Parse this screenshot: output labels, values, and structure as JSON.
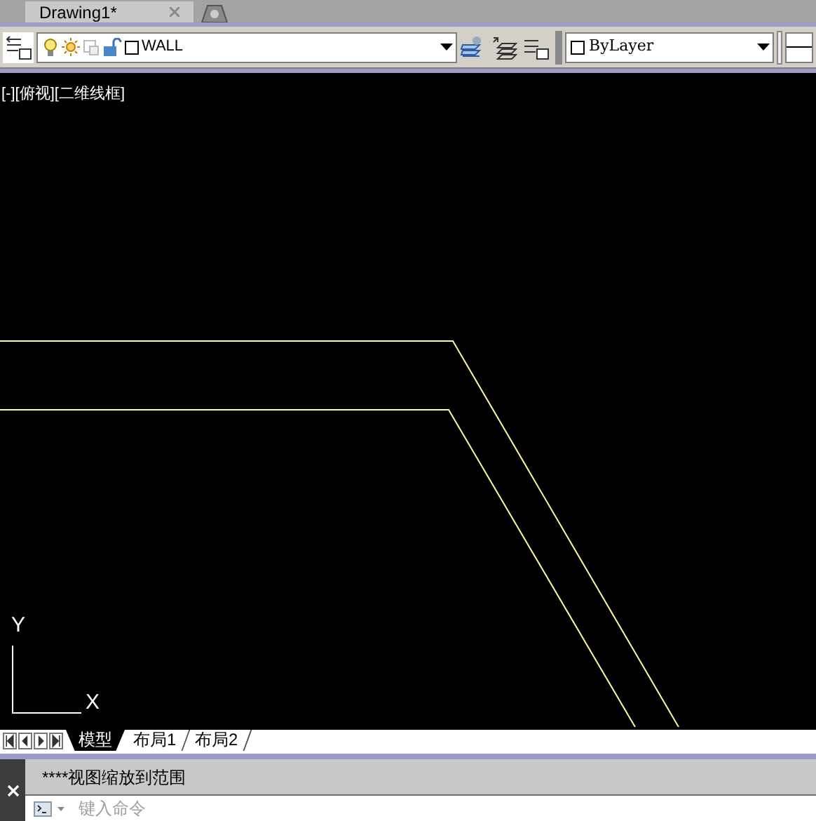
{
  "document_tabs": [
    {
      "label": "Drawing1*",
      "selected": true
    }
  ],
  "layer_toolbar": {
    "layer_name": "WALL",
    "color_value": "ByLayer"
  },
  "viewport_label": "[-][俯视][二维线框]",
  "ucs": {
    "x_label": "X",
    "y_label": "Y"
  },
  "layout_tabs": [
    {
      "label": "模型",
      "selected": true
    },
    {
      "label": "布局1",
      "selected": false
    },
    {
      "label": "布局2",
      "selected": false
    }
  ],
  "command_history": "****视图缩放到范围",
  "command_input": {
    "placeholder": "键入命令"
  }
}
